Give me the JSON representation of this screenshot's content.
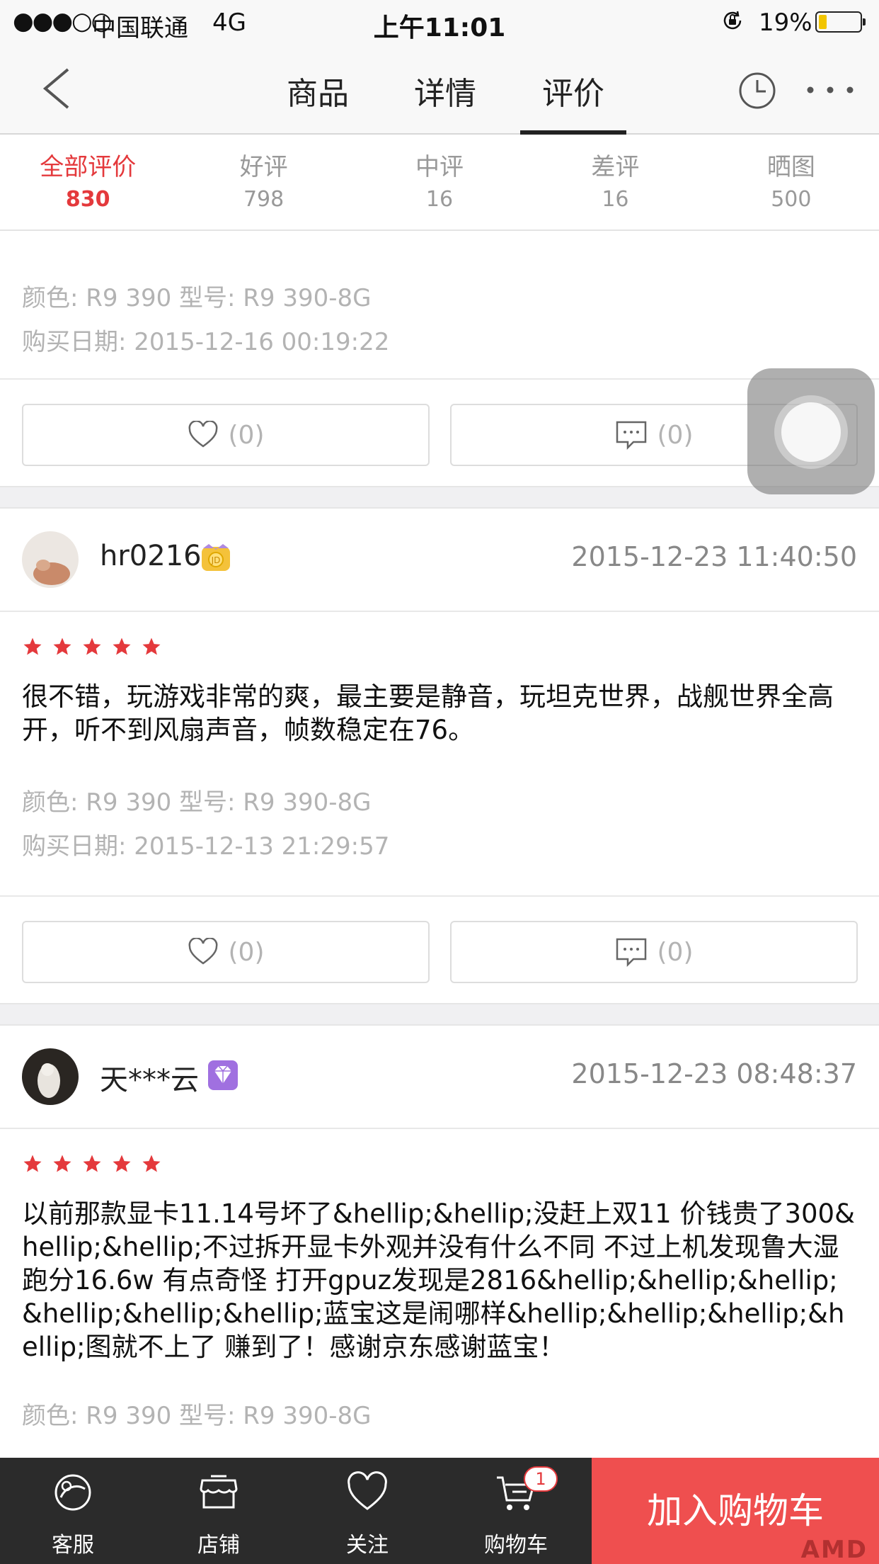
{
  "status_bar": {
    "signal": "●●●○○",
    "carrier": "中国联通",
    "network": "4G",
    "time": "上午11:01",
    "battery_pct": "19%",
    "battery_level": 0.19
  },
  "nav": {
    "tabs": [
      {
        "label": "商品"
      },
      {
        "label": "详情"
      },
      {
        "label": "评价"
      }
    ],
    "active_tab": "评价"
  },
  "filters": [
    {
      "label": "全部评价",
      "count": "830",
      "active": true
    },
    {
      "label": "好评",
      "count": "798"
    },
    {
      "label": "中评",
      "count": "16"
    },
    {
      "label": "差评",
      "count": "16"
    },
    {
      "label": "晒图",
      "count": "500"
    }
  ],
  "reviews": [
    {
      "color_spec": "颜色: R9 390  型号: R9 390-8G",
      "purchase_date": "购买日期: 2015-12-16 00:19:22",
      "likes": "(0)",
      "comments": "(0)"
    },
    {
      "user": "hr0216",
      "badge": "jd-member-badge",
      "date": "2015-12-23 11:40:50",
      "stars": 5,
      "text": "很不错，玩游戏非常的爽，最主要是静音，玩坦克世界，战舰世界全高开，听不到风扇声音，帧数稳定在76。",
      "color_spec": "颜色: R9 390  型号: R9 390-8G",
      "purchase_date": "购买日期: 2015-12-13 21:29:57",
      "likes": "(0)",
      "comments": "(0)"
    },
    {
      "user": "天***云",
      "badge": "diamond-badge",
      "date": "2015-12-23 08:48:37",
      "stars": 5,
      "text": "以前那款显卡11.14号坏了&hellip;&hellip;没赶上双11 价钱贵了300&hellip;&hellip;不过拆开显卡外观并没有什么不同 不过上机发现鲁大湿跑分16.6w 有点奇怪 打开gpuz发现是2816&hellip;&hellip;&hellip;&hellip;&hellip;&hellip;蓝宝这是闹哪样&hellip;&hellip;&hellip;&hellip;图就不上了 赚到了！感谢京东感谢蓝宝！",
      "color_spec": "颜色: R9 390  型号: R9 390-8G"
    }
  ],
  "bottom_bar": {
    "items": [
      {
        "label": "客服",
        "icon": "headset-icon"
      },
      {
        "label": "店铺",
        "icon": "shop-icon"
      },
      {
        "label": "关注",
        "icon": "heart-icon"
      },
      {
        "label": "购物车",
        "icon": "cart-icon"
      }
    ],
    "cart_count": "1",
    "add_to_cart": "加入购物车",
    "watermark": "AMD"
  },
  "colors": {
    "accent": "#e4393c",
    "add_to_cart_bg": "#ef4f4f",
    "bottom_bar_bg": "#2b2b2b",
    "muted_text": "#b3b3b3"
  }
}
